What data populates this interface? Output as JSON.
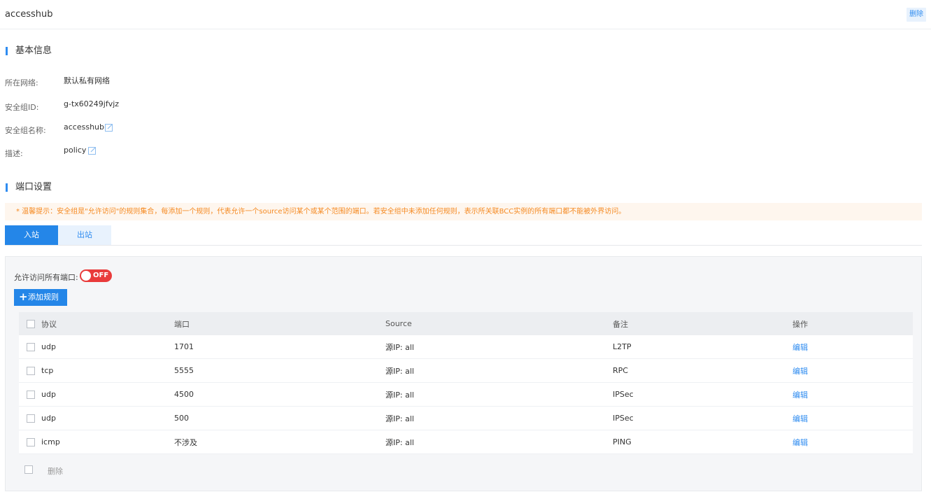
{
  "header": {
    "title": "accesshub",
    "delete_label": "删除"
  },
  "basic_info": {
    "section_title": "基本信息",
    "rows": [
      {
        "label": "所在网络:",
        "value": "默认私有网络",
        "editable": false
      },
      {
        "label": "安全组ID:",
        "value": "g-tx60249jfvjz",
        "editable": false
      },
      {
        "label": "安全组名称:",
        "value": "accesshub",
        "editable": true
      },
      {
        "label": "描述:",
        "value": "policy",
        "editable": true
      }
    ]
  },
  "ports": {
    "section_title": "端口设置",
    "tip": "* 温馨提示：安全组是\"允许访问\"的规则集合，每添加一个规则，代表允许一个source访问某个或某个范围的端口。若安全组中未添加任何规则，表示所关联BCC实例的所有端口都不能被外界访问。",
    "tabs": [
      {
        "label": "入站",
        "active": true
      },
      {
        "label": "出站",
        "active": false
      }
    ],
    "allow_all_label": "允许访问所有端口:",
    "toggle_state": "OFF",
    "add_rule_label": "添加规则",
    "columns": [
      "协议",
      "端口",
      "Source",
      "备注",
      "操作"
    ],
    "rows": [
      {
        "protocol": "udp",
        "port": "1701",
        "source": "源IP: all",
        "remark": "L2TP",
        "action": "编辑"
      },
      {
        "protocol": "tcp",
        "port": "5555",
        "source": "源IP: all",
        "remark": "RPC",
        "action": "编辑"
      },
      {
        "protocol": "udp",
        "port": "4500",
        "source": "源IP: all",
        "remark": "IPSec",
        "action": "编辑"
      },
      {
        "protocol": "udp",
        "port": "500",
        "source": "源IP: all",
        "remark": "IPSec",
        "action": "编辑"
      },
      {
        "protocol": "icmp",
        "port": "不涉及",
        "source": "源IP: all",
        "remark": "PING",
        "action": "编辑"
      }
    ],
    "footer_delete_label": "删除"
  },
  "colors": {
    "accent": "#2486e8",
    "toggle_off": "#e93b3b",
    "tip_text": "#f58a22",
    "tip_bg": "#fef6ee"
  }
}
